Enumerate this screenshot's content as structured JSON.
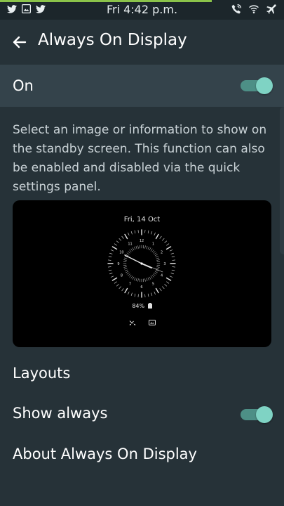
{
  "status_bar": {
    "time": "Fri 4:42 p.m.",
    "left_icons": [
      "twitter-icon",
      "gallery-icon",
      "twitter-icon"
    ],
    "right_icons": [
      "wifi-calling-icon",
      "wifi-icon",
      "airplane-mode-icon"
    ],
    "accent_color": "#8bc34a"
  },
  "header": {
    "title": "Always On Display",
    "back_icon": "arrow-left-icon"
  },
  "master_switch": {
    "label": "On",
    "state": true,
    "accent_color": "#7fd3c4"
  },
  "description": "Select an image or information to show on the standby screen. This function can also be enabled and disabled via the quick settings panel.",
  "preview": {
    "date": "Fri, 14 Oct",
    "clock_numbers": [
      "12",
      "1",
      "2",
      "3",
      "4",
      "5",
      "6",
      "7",
      "8",
      "9",
      "10",
      "11"
    ],
    "battery": "84%",
    "bottom_icons": [
      "missed-call-icon",
      "message-icon"
    ]
  },
  "menu": {
    "layouts": "Layouts",
    "show_always": "Show always",
    "show_always_state": true,
    "about": "About Always On Display"
  }
}
